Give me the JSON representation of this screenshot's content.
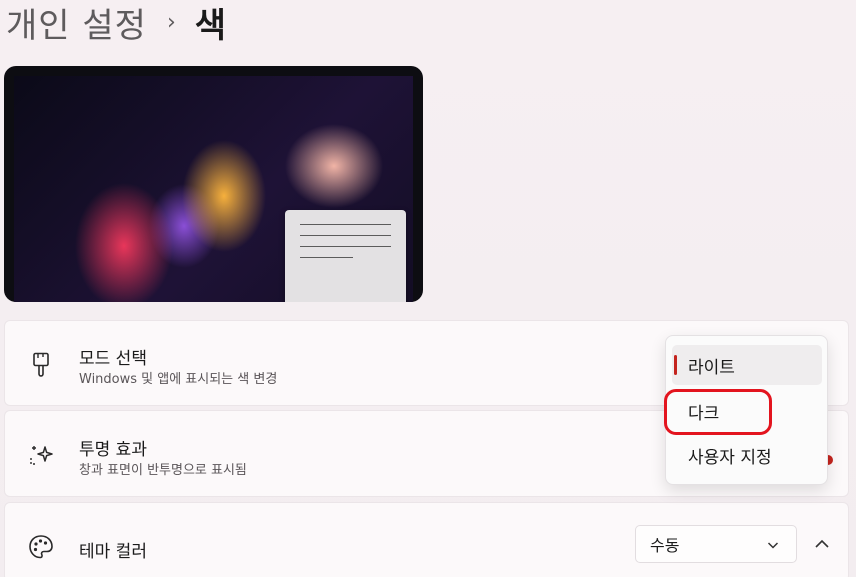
{
  "breadcrumb": {
    "parent": "개인 설정",
    "separator": "›",
    "current": "색"
  },
  "settings": {
    "mode": {
      "title": "모드 선택",
      "subtitle": "Windows 및 앱에 표시되는 색 변경",
      "icon": "brush-icon"
    },
    "transparency": {
      "title": "투명 효과",
      "subtitle": "창과 표면이 반투명으로 표시됨",
      "icon": "sparkle-icon"
    },
    "accent": {
      "title": "테마 컬러",
      "icon": "palette-icon",
      "selected_value": "수동"
    }
  },
  "mode_menu": {
    "options": [
      "라이트",
      "다크",
      "사용자 지정"
    ],
    "selected_index": 0,
    "highlighted_index": 1
  },
  "colors": {
    "accent": "#c4241e",
    "highlight_ring": "#e3141e"
  }
}
